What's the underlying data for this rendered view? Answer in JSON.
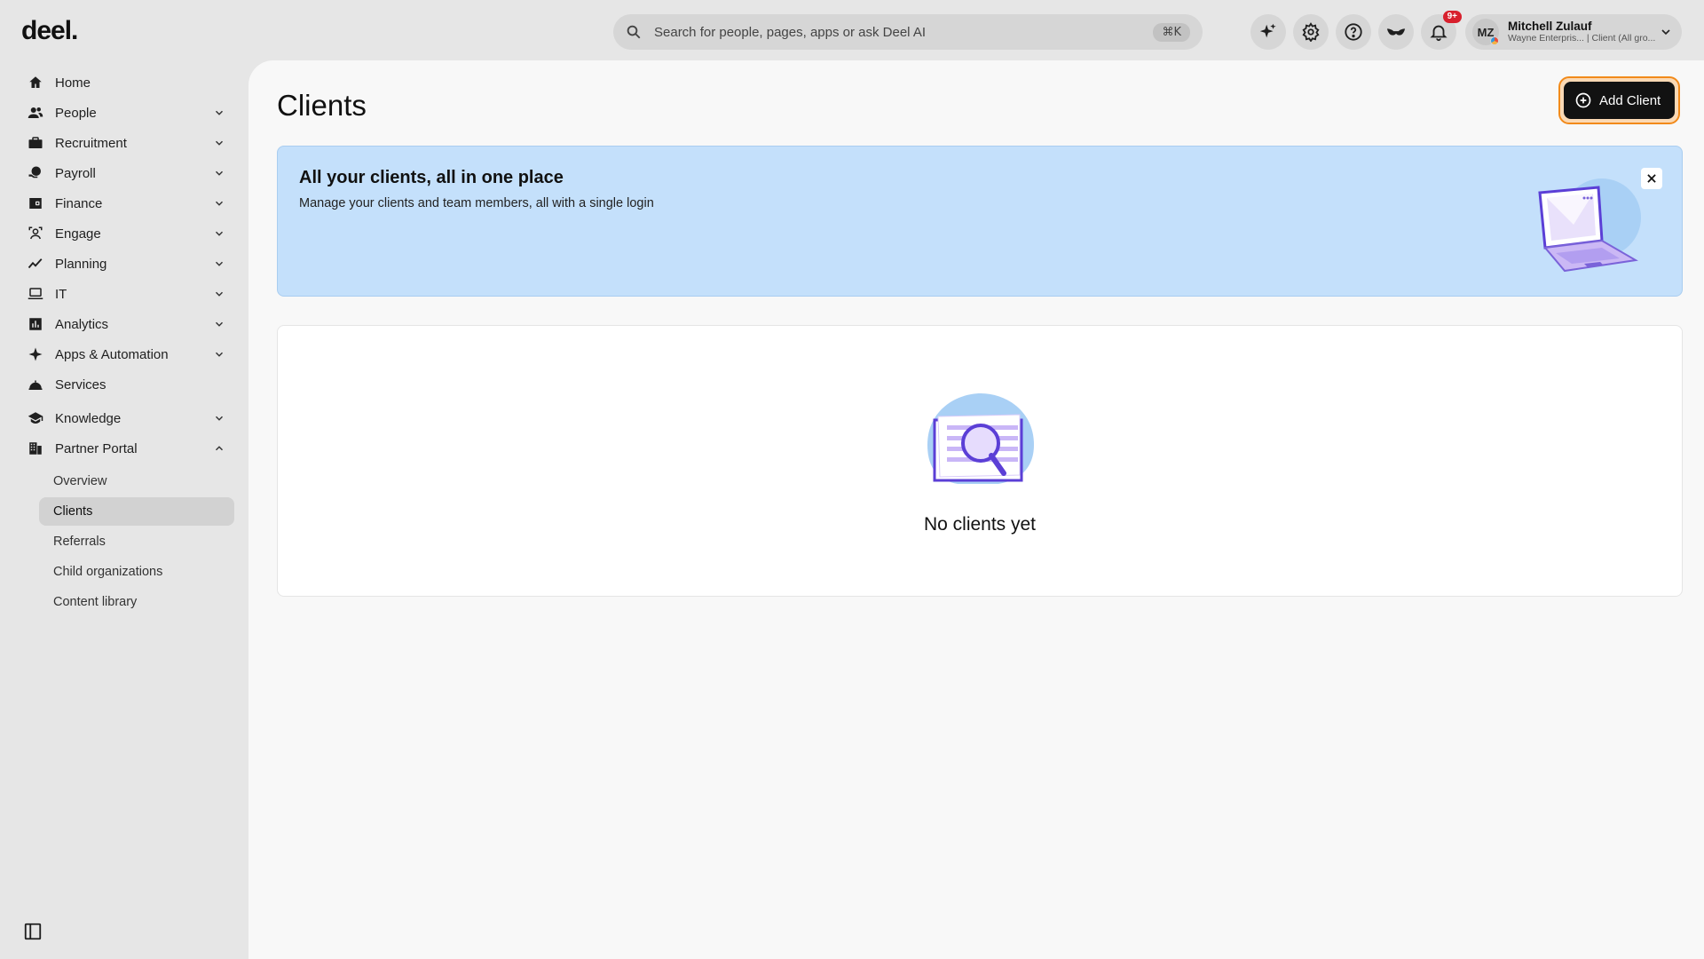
{
  "brand": {
    "logo_text": "deel."
  },
  "search": {
    "placeholder": "Search for people, pages, apps or ask Deel AI",
    "shortcut": "⌘K"
  },
  "notifications": {
    "badge": "9+"
  },
  "profile": {
    "initials": "MZ",
    "name": "Mitchell Zulauf",
    "subtitle": "Wayne Enterpris... | Client (All gro..."
  },
  "sidebar": {
    "items": [
      {
        "label": "Home",
        "icon": "home-icon",
        "expandable": false
      },
      {
        "label": "People",
        "icon": "people-icon",
        "expandable": true
      },
      {
        "label": "Recruitment",
        "icon": "briefcase-icon",
        "expandable": true
      },
      {
        "label": "Payroll",
        "icon": "payroll-icon",
        "expandable": true
      },
      {
        "label": "Finance",
        "icon": "wallet-icon",
        "expandable": true
      },
      {
        "label": "Engage",
        "icon": "engage-icon",
        "expandable": true
      },
      {
        "label": "Planning",
        "icon": "trend-icon",
        "expandable": true
      },
      {
        "label": "IT",
        "icon": "laptop-icon",
        "expandable": true
      },
      {
        "label": "Analytics",
        "icon": "analytics-icon",
        "expandable": true
      },
      {
        "label": "Apps & Automation",
        "icon": "sparkle-icon",
        "expandable": true
      },
      {
        "label": "Services",
        "icon": "service-bell-icon",
        "expandable": false
      },
      {
        "label": "Knowledge",
        "icon": "graduation-cap-icon",
        "expandable": true
      },
      {
        "label": "Partner Portal",
        "icon": "building-icon",
        "expandable": true,
        "expanded": true
      }
    ],
    "partner_portal_sub": [
      {
        "label": "Overview",
        "active": false
      },
      {
        "label": "Clients",
        "active": true
      },
      {
        "label": "Referrals",
        "active": false
      },
      {
        "label": "Child organizations",
        "active": false
      },
      {
        "label": "Content library",
        "active": false
      }
    ]
  },
  "main": {
    "title": "Clients",
    "add_button_label": "Add Client",
    "banner": {
      "title": "All your clients, all in one place",
      "subtitle": "Manage your clients and team members, all with a single login"
    },
    "empty_state": {
      "text": "No clients yet"
    }
  },
  "colors": {
    "accent_focus": "#f28a1a",
    "banner_bg": "#c4e0fb",
    "illustration_purple": "#5b3fd6",
    "badge_red": "#d8202d"
  }
}
